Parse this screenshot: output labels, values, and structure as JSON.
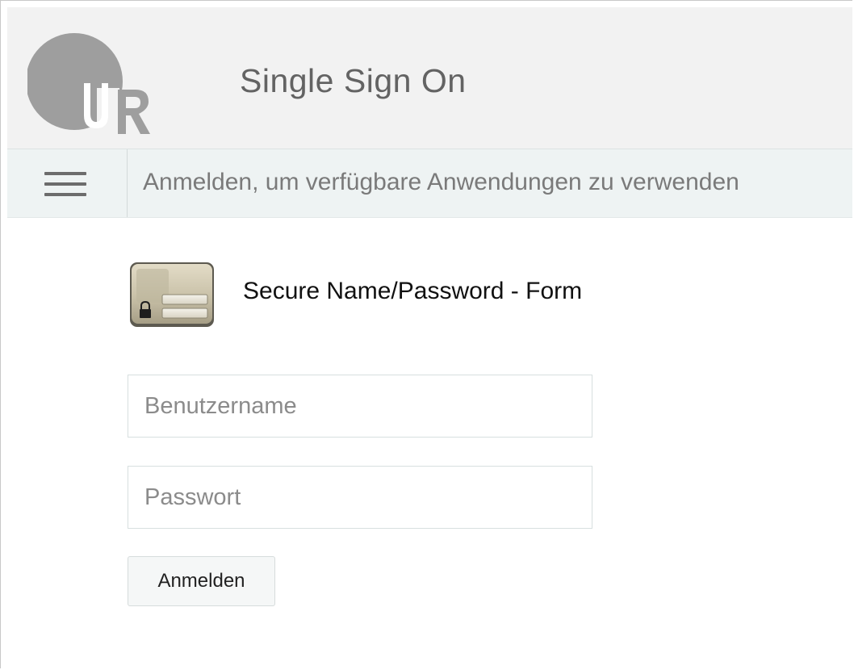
{
  "header": {
    "logo_icon": "university-ur-logo",
    "title": "Single Sign On"
  },
  "nav": {
    "menu_icon": "hamburger-menu-icon",
    "text": "Anmelden, um verfügbare Anwendungen zu verwenden"
  },
  "login": {
    "method_icon": "secure-form-lock-icon",
    "method_title": "Secure Name/Password - Form",
    "username_placeholder": "Benutzername",
    "username_value": "",
    "password_placeholder": "Passwort",
    "password_value": "",
    "submit_label": "Anmelden"
  },
  "colors": {
    "header_bg": "#f2f2f2",
    "navbar_bg": "#eef3f3",
    "logo_gray": "#9e9e9e"
  }
}
